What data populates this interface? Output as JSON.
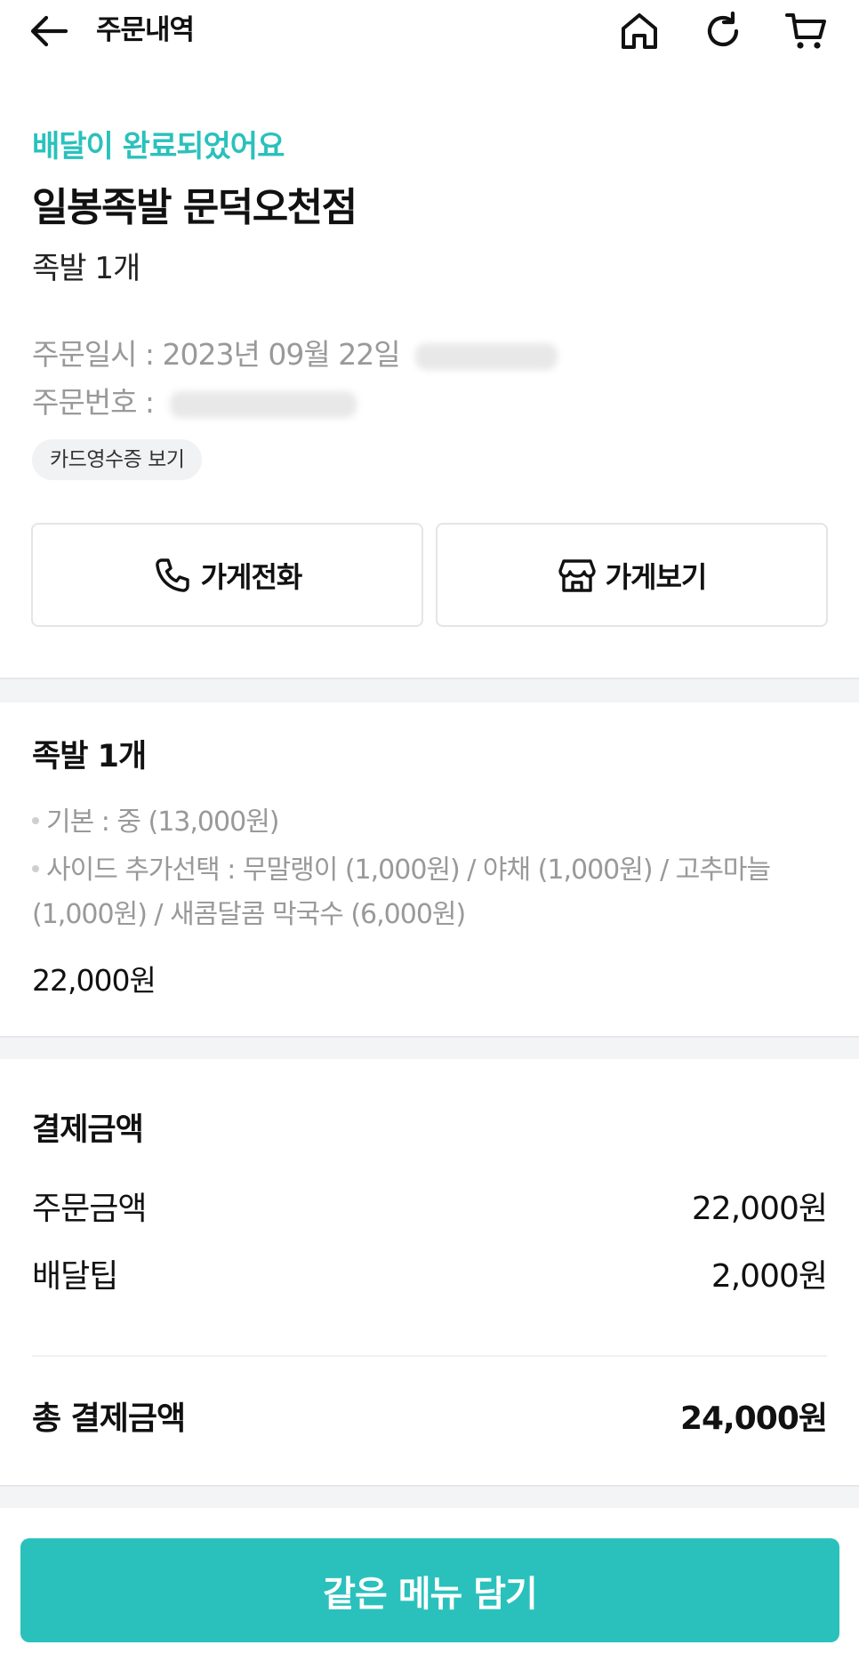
{
  "header": {
    "title": "주문내역",
    "icons": [
      "back-arrow-icon",
      "home-icon",
      "refresh-icon",
      "cart-icon"
    ]
  },
  "order": {
    "status": "배달이 완료되었어요",
    "store_name": "일봉족발 문덕오천점",
    "summary": "족발 1개",
    "date_label": "주문일시 : ",
    "date_value": "2023년 09월 22일",
    "number_label": "주문번호 : ",
    "receipt_label": "카드영수증 보기"
  },
  "actions": {
    "call_label": "가게전화",
    "store_label": "가게보기"
  },
  "menu": {
    "title": "족발 1개",
    "options": [
      "기본 : 중 (13,000원)",
      "사이드 추가선택 : 무말랭이 (1,000원) / 야채 (1,000원) / 고추마늘 (1,000원) / 새콤달콤 막국수 (6,000원)"
    ],
    "price": "22,000원"
  },
  "payment": {
    "title": "결제금액",
    "order_amount_label": "주문금액",
    "order_amount_value": "22,000원",
    "delivery_tip_label": "배달팁",
    "delivery_tip_value": "2,000원",
    "total_label": "총 결제금액",
    "total_value": "24,000원"
  },
  "bottom": {
    "add_same_menu_label": "같은 메뉴 담기"
  },
  "colors": {
    "accent": "#2ac1bc",
    "muted_text": "#999999",
    "border": "#e3e5e8"
  }
}
